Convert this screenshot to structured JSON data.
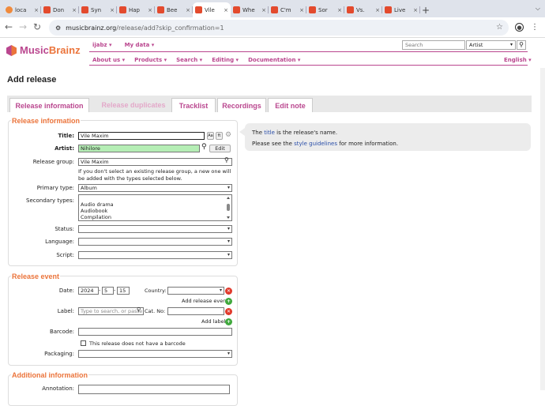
{
  "browser": {
    "tabs": [
      {
        "label": "loca",
        "icon": "music-note-icon"
      },
      {
        "label": "Don",
        "icon": "musicbrainz-icon"
      },
      {
        "label": "Syn",
        "icon": "musicbrainz-icon"
      },
      {
        "label": "Hap",
        "icon": "musicbrainz-icon"
      },
      {
        "label": "Bee",
        "icon": "musicbrainz-icon"
      },
      {
        "label": "Vile",
        "icon": "musicbrainz-icon",
        "active": true
      },
      {
        "label": "Whe",
        "icon": "musicbrainz-icon"
      },
      {
        "label": "C'm",
        "icon": "musicbrainz-icon"
      },
      {
        "label": "Sor",
        "icon": "musicbrainz-icon"
      },
      {
        "label": "Vs.",
        "icon": "musicbrainz-icon"
      },
      {
        "label": "Live",
        "icon": "musicbrainz-icon"
      }
    ],
    "url_host": "musicbrainz.org",
    "url_path": "/release/add?skip_confirmation=1"
  },
  "site": {
    "logo_music": "Music",
    "logo_brainz": "Brainz",
    "user": "ijabz",
    "my_data": "My data",
    "search_placeholder": "Search",
    "search_type": "Artist",
    "menu": [
      "About us",
      "Products",
      "Search",
      "Editing",
      "Documentation"
    ],
    "language": "English",
    "accent": "#ba478f",
    "orange": "#eb743b"
  },
  "page": {
    "title": "Add release",
    "tabs": [
      "Release information",
      "Release duplicates",
      "Tracklist",
      "Recordings",
      "Edit note"
    ]
  },
  "release_info": {
    "legend": "Release information",
    "title_label": "Title:",
    "title_value": "Vile Maxim",
    "artist_label": "Artist:",
    "artist_value": "Nihilore",
    "edit_button": "Edit",
    "group_label": "Release group:",
    "group_value": "Vile Maxim",
    "group_note": "If you don't select an existing release group, a new one will be added with the types selected below.",
    "primary_label": "Primary type:",
    "primary_value": "Album",
    "secondary_label": "Secondary types:",
    "secondary_options": [
      "Audio drama",
      "Audiobook",
      "Compilation"
    ],
    "status_label": "Status:",
    "language_label": "Language:",
    "script_label": "Script:"
  },
  "release_event": {
    "legend": "Release event",
    "date_label": "Date:",
    "year": "2024",
    "month": "5",
    "day": "15",
    "country_label": "Country:",
    "add_event": "Add release event",
    "label_label": "Label:",
    "label_placeholder": "Type to search, or paste",
    "catno_label": "Cat. No:",
    "add_label": "Add label",
    "barcode_label": "Barcode:",
    "no_barcode": "This release does not have a barcode",
    "packaging_label": "Packaging:"
  },
  "additional": {
    "legend": "Additional information",
    "annotation_label": "Annotation:"
  },
  "help": {
    "line1_pre": "The ",
    "line1_link": "title",
    "line1_post": " is the release's name.",
    "line2_pre": "Please see the ",
    "line2_link": "style guidelines",
    "line2_post": " for more information."
  }
}
